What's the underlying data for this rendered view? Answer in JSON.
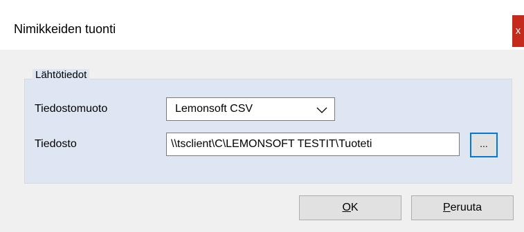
{
  "dialog": {
    "title": "Nimikkeiden tuonti",
    "close_label": "x"
  },
  "group": {
    "title": "Lähtötiedot",
    "format_label": "Tiedostomuoto",
    "format_value": "Lemonsoft CSV",
    "file_label": "Tiedosto",
    "file_value": "\\\\tsclient\\C\\LEMONSOFT TESTIT\\Tuoteti",
    "browse_label": "..."
  },
  "buttons": {
    "ok_mnemonic": "O",
    "ok_rest": "K",
    "cancel_mnemonic": "P",
    "cancel_rest": "eruuta"
  },
  "colors": {
    "close_button": "#c42b1c",
    "group_background": "#dde6f2",
    "focus_border": "#0078d7"
  },
  "icons": {
    "combo_arrow": "chevron-down-icon"
  }
}
